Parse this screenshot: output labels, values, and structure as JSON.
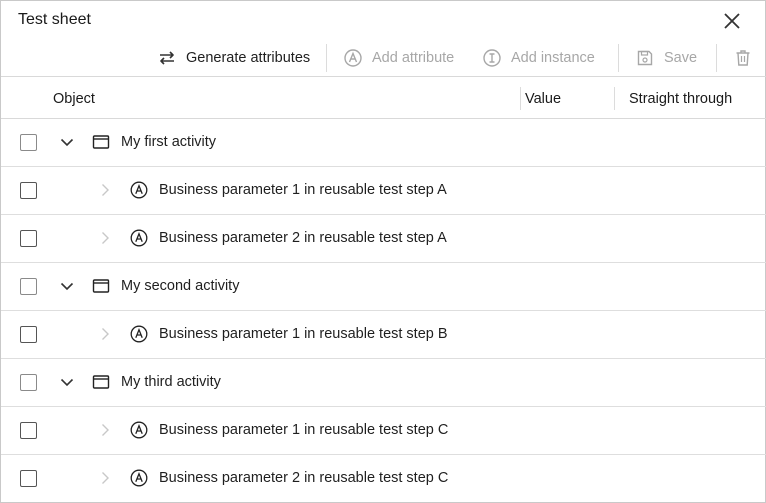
{
  "dialog": {
    "title": "Test sheet"
  },
  "toolbar": {
    "generate_label": "Generate attributes",
    "add_attribute_label": "Add attribute",
    "add_instance_label": "Add instance",
    "save_label": "Save"
  },
  "table": {
    "columns": {
      "object": "Object",
      "value": "Value",
      "straight_through": "Straight through"
    },
    "rows": [
      {
        "type": "activity",
        "label": "My first activity",
        "expanded": true
      },
      {
        "type": "attribute",
        "label": "Business parameter 1 in reusable test step A"
      },
      {
        "type": "attribute",
        "label": "Business parameter 2 in reusable test step A"
      },
      {
        "type": "activity",
        "label": "My second activity",
        "expanded": true
      },
      {
        "type": "attribute",
        "label": "Business parameter 1 in reusable test step B"
      },
      {
        "type": "activity",
        "label": "My third activity",
        "expanded": true
      },
      {
        "type": "attribute",
        "label": "Business parameter 1 in reusable test step C"
      },
      {
        "type": "attribute",
        "label": "Business parameter 2 in reusable test step C"
      }
    ]
  },
  "colors": {
    "text": "#1f1f1f",
    "disabled": "#a7a7a7",
    "border": "#d9d9d9"
  },
  "icons": {
    "close": "close-icon",
    "generate": "swap-arrows-icon",
    "add_attribute": "attribute-a-icon",
    "add_instance": "instance-i-icon",
    "save": "save-disk-icon",
    "delete": "trash-icon",
    "expand": "chevron-down-icon",
    "collapsed": "chevron-right-icon",
    "activity": "window-icon",
    "attribute": "attribute-a-icon"
  }
}
